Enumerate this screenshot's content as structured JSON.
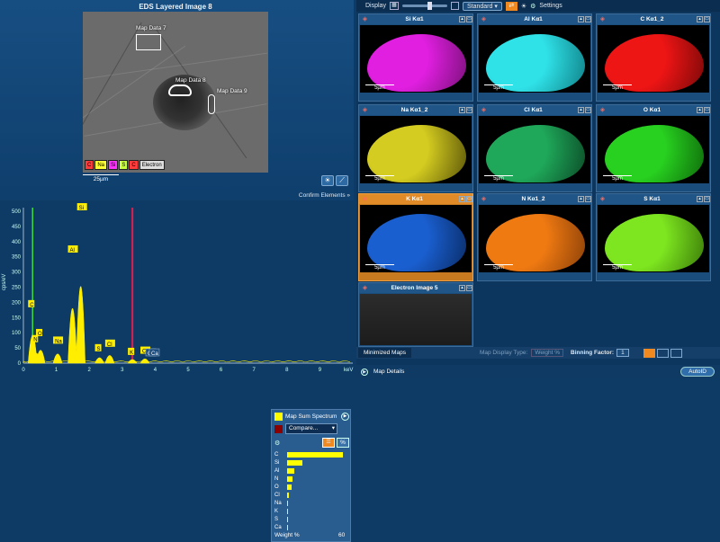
{
  "left_image": {
    "title": "EDS Layered Image 8",
    "map7_label": "Map Data 7",
    "map8_label": "Map Data 8",
    "map9_label": "Map Data 9",
    "chips": [
      {
        "label": "C",
        "color": "#ff3b3b"
      },
      {
        "label": "Na",
        "color": "#ffff33"
      },
      {
        "label": "Si",
        "color": "#ff33ff"
      },
      {
        "label": "S",
        "color": "#c8ff3c"
      },
      {
        "label": "C",
        "color": "#ff3b3b"
      },
      {
        "label": "Electron",
        "color": "#dddddd"
      }
    ],
    "scale": "25µm"
  },
  "confirm": {
    "label": "Confirm Elements »"
  },
  "spectrum": {
    "ylabel": "cps/eV",
    "xunit": "keV",
    "yticks": [
      "500",
      "450",
      "400",
      "350",
      "300",
      "250",
      "200",
      "150",
      "100",
      "50",
      "0"
    ],
    "xticks": [
      "0",
      "1",
      "2",
      "3",
      "4",
      "5",
      "6",
      "7",
      "8",
      "9"
    ],
    "peaks": [
      {
        "label": "C",
        "kev": 0.28,
        "value": 175
      },
      {
        "label": "N",
        "kev": 0.39,
        "value": 60
      },
      {
        "label": "O",
        "kev": 0.52,
        "value": 80
      },
      {
        "label": "Na",
        "kev": 1.04,
        "value": 55
      },
      {
        "label": "Al",
        "kev": 1.49,
        "value": 355
      },
      {
        "label": "Si",
        "kev": 1.74,
        "value": 500
      },
      {
        "label": "S",
        "kev": 2.31,
        "value": 30
      },
      {
        "label": "Cl",
        "kev": 2.62,
        "value": 45
      },
      {
        "label": "K",
        "kev": 3.31,
        "value": 18
      },
      {
        "label": "Ca",
        "kev": 3.69,
        "value": 22
      }
    ],
    "extra_labels": [
      "Cl",
      "Ca"
    ]
  },
  "legend": {
    "spectrum_name": "Map Sum Spectrum",
    "compare_label": "Compare...",
    "pct_label": "%",
    "elements": [
      {
        "el": "C",
        "weight": 60
      },
      {
        "el": "Si",
        "weight": 16
      },
      {
        "el": "Al",
        "weight": 8
      },
      {
        "el": "N",
        "weight": 6
      },
      {
        "el": "O",
        "weight": 5
      },
      {
        "el": "Cl",
        "weight": 2
      },
      {
        "el": "Na",
        "weight": 1
      },
      {
        "el": "K",
        "weight": 0.5
      },
      {
        "el": "S",
        "weight": 0.5
      },
      {
        "el": "Ca",
        "weight": 0.5
      }
    ],
    "axis_label": "Weight %",
    "axis_max": "60",
    "colors": {
      "bar": "#ffff00",
      "swatch_compare": "#8b0000"
    }
  },
  "toolbar": {
    "display_label": "Display",
    "standard_label": "Standard",
    "settings_label": "Settings"
  },
  "maps": [
    {
      "title": "Si Kα1",
      "color": "#e01fe0",
      "dark": "#7a107a",
      "scale": "5µm"
    },
    {
      "title": "Al Kα1",
      "color": "#2fe2e8",
      "dark": "#0f7f86",
      "scale": "5µm"
    },
    {
      "title": "C Kα1_2",
      "color": "#ee1515",
      "dark": "#7a0808",
      "scale": "5µm"
    },
    {
      "title": "Na Kα1_2",
      "color": "#d4cc20",
      "dark": "#5a5408",
      "scale": "5µm"
    },
    {
      "title": "Cl Kα1",
      "color": "#1fa85a",
      "dark": "#0b4a26",
      "scale": "5µm"
    },
    {
      "title": "O Kα1",
      "color": "#28d020",
      "dark": "#0e6a0a",
      "scale": "5µm"
    },
    {
      "title": "K Kα1",
      "color": "#1a5fd0",
      "dark": "#0a2c66",
      "scale": "5µm"
    },
    {
      "title": "N Kα1_2",
      "color": "#f07a12",
      "dark": "#8a4008",
      "scale": "5µm"
    },
    {
      "title": "S Kα1",
      "color": "#7ee620",
      "dark": "#3a7a08",
      "scale": "5µm"
    },
    {
      "title": "Electron Image 5",
      "color": "#2a2a2a",
      "dark": "#1a1a1a",
      "scale": ""
    }
  ],
  "bottom": {
    "minimized": "Minimized Maps",
    "map_display_type": "Map Display Type:",
    "weight_pct": "Weight %",
    "binning_label": "Binning Factor:",
    "binning_value": "1",
    "map_details": "Map Details",
    "autoid": "AutoID"
  }
}
